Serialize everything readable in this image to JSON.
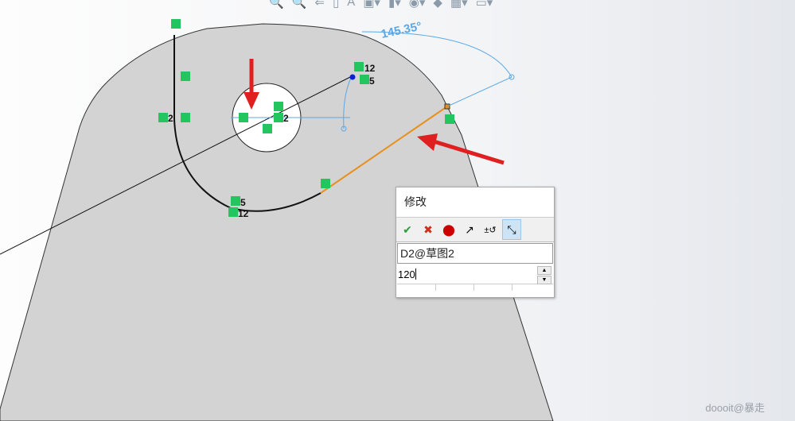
{
  "toolbar": {
    "icons": [
      "zoom-to-fit-icon",
      "zoom-area-icon",
      "previous-view-icon",
      "section-view-icon",
      "dynamic-annotation-icon",
      "view-orientation-icon",
      "display-style-icon",
      "hide-show-icon",
      "edit-appearance-icon",
      "apply-scene-icon",
      "view-settings-icon"
    ]
  },
  "sketch": {
    "angle_dimension": "145.35°",
    "relation_labels": {
      "r12a": "12",
      "r5a": "5",
      "r2a": "2",
      "r2b": "2",
      "r5b": "5",
      "r12b": "12"
    }
  },
  "dialog": {
    "title": "修改",
    "dimension_name": "D2@草图2",
    "value": "120",
    "buttons": {
      "ok": "✔",
      "cancel": "✖"
    }
  },
  "watermark": "doooit@暴走",
  "colors": {
    "part": "#d3d3d3",
    "sketch_line": "#111111",
    "construction": "#5aa8e6",
    "selected": "#e8901e",
    "relation": "#22c55e",
    "arrow": "#e02020"
  }
}
